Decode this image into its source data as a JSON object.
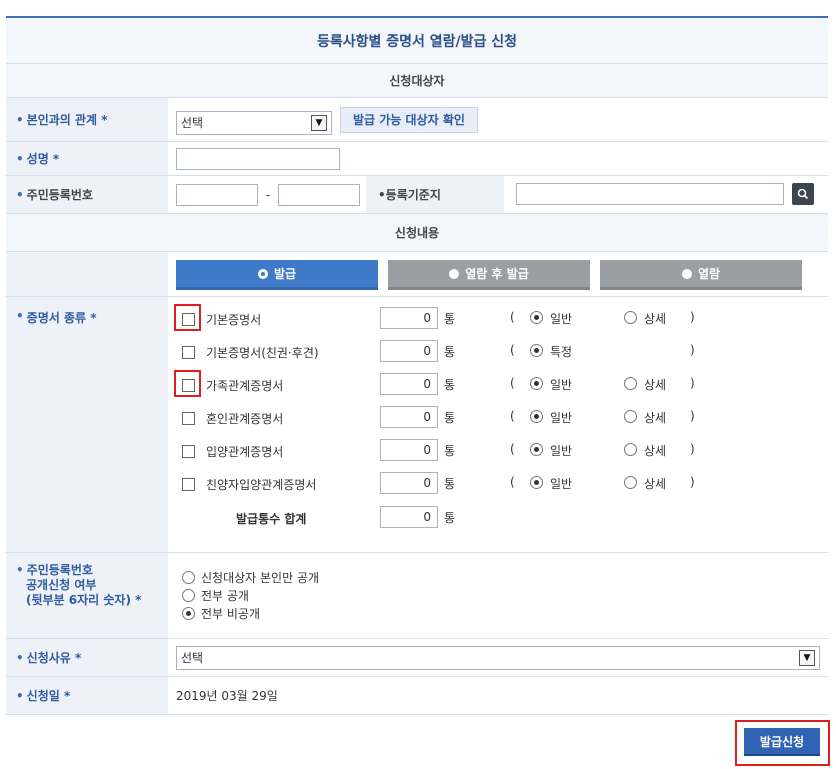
{
  "form": {
    "title": "등록사항별 증명서 열람/발급 신청",
    "section_applicant": "신청대상자",
    "section_content": "신청내용"
  },
  "relation": {
    "label": "본인과의 관계 *",
    "select_value": "선택",
    "check_button": "발급 가능 대상자 확인"
  },
  "name": {
    "label": "성명 *",
    "value": ""
  },
  "rrn": {
    "label": "주민등록번호",
    "separator": "-",
    "part1": "",
    "part2": ""
  },
  "reg_base": {
    "label": "등록기준지",
    "value": ""
  },
  "tabs": [
    {
      "label": "발급",
      "active": true
    },
    {
      "label": "열람 후 발급",
      "active": false
    },
    {
      "label": "열람",
      "active": false
    }
  ],
  "cert_type": {
    "label": "증명서 종류 *",
    "unit": "통",
    "paren_open": "(",
    "paren_close": ")",
    "items": [
      {
        "name": "기본증명서",
        "qty": "0",
        "opt1": "일반",
        "opt2": "상세"
      },
      {
        "name": "기본증명서(친권·후견)",
        "qty": "0",
        "opt1": "특정",
        "opt2": ""
      },
      {
        "name": "가족관계증명서",
        "qty": "0",
        "opt1": "일반",
        "opt2": "상세"
      },
      {
        "name": "혼인관계증명서",
        "qty": "0",
        "opt1": "일반",
        "opt2": "상세"
      },
      {
        "name": "입양관계증명서",
        "qty": "0",
        "opt1": "일반",
        "opt2": "상세"
      },
      {
        "name": "친양자입양관계증명서",
        "qty": "0",
        "opt1": "일반",
        "opt2": "상세"
      }
    ],
    "total_label": "발급통수 합계",
    "total_qty": "0"
  },
  "disclosure": {
    "label_line1": "주민등록번호",
    "label_line2": "공개신청 여부",
    "label_line3": "(뒷부분 6자리 숫자) *",
    "options": [
      {
        "label": "신청대상자 본인만 공개",
        "checked": false
      },
      {
        "label": "전부 공개",
        "checked": false
      },
      {
        "label": "전부 비공개",
        "checked": true
      }
    ]
  },
  "reason": {
    "label": "신청사유 *",
    "select_value": "선택"
  },
  "date": {
    "label": "신청일 *",
    "value": "2019년 03월 29일"
  },
  "submit_label": "발급신청",
  "colors": {
    "accent": "#3f7ac8",
    "highlight": "#e21d1d",
    "label_text": "#2f5aa0"
  }
}
